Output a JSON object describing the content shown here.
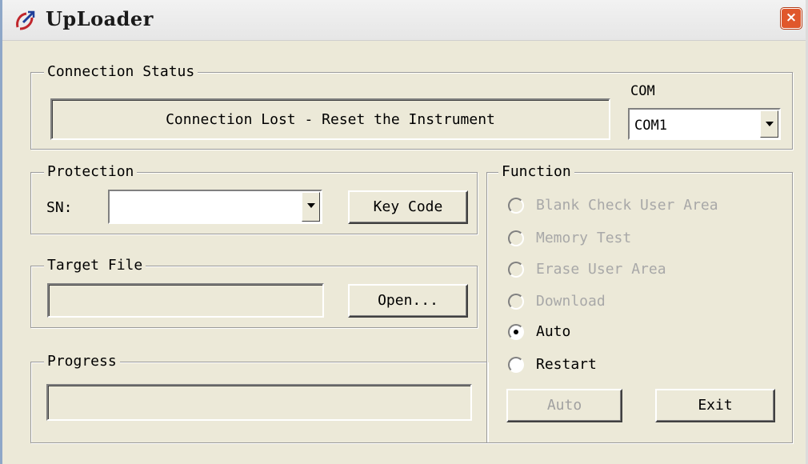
{
  "window": {
    "title": "UpLoader",
    "close_glyph": "×"
  },
  "connection": {
    "legend": "Connection Status",
    "status_text": "Connection Lost - Reset the Instrument",
    "com_label": "COM",
    "com_selected": "COM1"
  },
  "protection": {
    "legend": "Protection",
    "sn_label": "SN:",
    "sn_value": "",
    "key_code_button": "Key Code"
  },
  "target_file": {
    "legend": "Target File",
    "path_value": "",
    "open_button": "Open..."
  },
  "progress": {
    "legend": "Progress",
    "value": 0
  },
  "function": {
    "legend": "Function",
    "options": [
      {
        "label": "Blank Check User Area",
        "enabled": false,
        "selected": false
      },
      {
        "label": "Memory Test",
        "enabled": false,
        "selected": false
      },
      {
        "label": "Erase User Area",
        "enabled": false,
        "selected": false
      },
      {
        "label": "Download",
        "enabled": false,
        "selected": false
      },
      {
        "label": "Auto",
        "enabled": true,
        "selected": true
      },
      {
        "label": "Restart",
        "enabled": true,
        "selected": false
      }
    ],
    "action_button": "Auto",
    "action_button_enabled": false,
    "exit_button": "Exit"
  },
  "icons": {
    "app": "uploader-app-icon",
    "close": "close-icon",
    "dropdown": "chevron-down-icon"
  }
}
